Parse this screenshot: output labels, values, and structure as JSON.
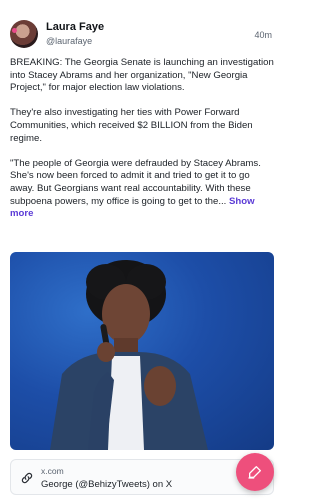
{
  "post": {
    "author": "Laura Faye",
    "handle": "@laurafaye",
    "time": "40m",
    "paragraphs": [
      "BREAKING: The Georgia Senate is launching an investigation into Stacey Abrams and her organization, \"New Georgia Project,\" for major election law violations.",
      "They're also investigating her ties with Power Forward Communities, which received $2 BILLION from the Biden regime.",
      "\"The people of Georgia were defrauded by Stacey Abrams. She's now been forced to admit it and tried to get it to go away. But Georgians want real accountability. With these subpoena powers, my office is going to get to the..."
    ],
    "show_more": "Show more"
  },
  "link_card": {
    "domain": "x.com",
    "title": "George (@BehizyTweets) on X"
  },
  "colors": {
    "accent": "#5b3bd6",
    "fab": "#ee4f7c"
  },
  "icons": {
    "link": "link-icon",
    "compose": "compose-icon"
  }
}
